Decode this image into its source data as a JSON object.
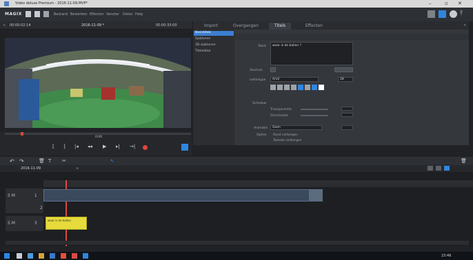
{
  "window": {
    "title": "Video deluxe Premium - 2016-11-09.MVP*"
  },
  "menubar": {
    "logo": "MAGIX",
    "menus": [
      "Bestand",
      "Bewerken",
      "Effecten",
      "Venster",
      "Delen",
      "Help"
    ]
  },
  "preview": {
    "timecode_left": "00:00:02:14",
    "project": "2016-11-09 *",
    "timecode_right": "00:00:33:00",
    "marker_time": "0:00"
  },
  "tabs": [
    "Import",
    "Overgangen",
    "Titels",
    "Effecten"
  ],
  "tree": [
    "Basistitels",
    "Sjablonen",
    "3D-sjablonen",
    "Titeleditor"
  ],
  "props": {
    "text_label": "Tekst",
    "text_value": "waar is de ballon ?",
    "style_label": "Lettertype",
    "font_value": "Arial",
    "size_value": "28",
    "shadow_label": "Schaduw",
    "transparency_label": "Transparantie",
    "blur_label": "Onscherpte",
    "anim_label": "Animatie",
    "anim_value": "Geen",
    "options_label": "Opties",
    "option1": "Rand verbergen",
    "option2": "Tweede verbergen"
  },
  "timeline": {
    "project_tab": "2016-11-09",
    "track1": "1",
    "track2": "2",
    "track3": "3",
    "track_prefix": "S M",
    "title_clip": "waar is de ballon"
  },
  "taskbar": {
    "clock": "23:46"
  }
}
